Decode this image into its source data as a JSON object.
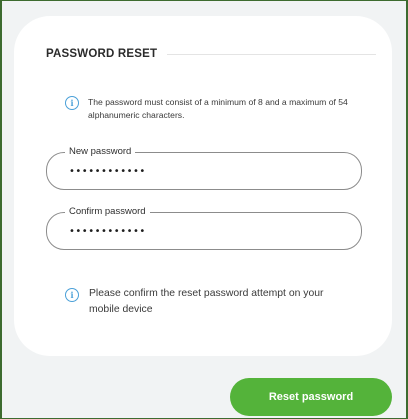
{
  "card": {
    "title": "PASSWORD RESET",
    "requirement_note": "The password must consist of a minimum of 8 and a maximum of 54 alphanumeric characters.",
    "new_password": {
      "label": "New password",
      "value": "••••••••••••"
    },
    "confirm_password": {
      "label": "Confirm password",
      "value": "••••••••••••"
    },
    "mobile_note": "Please confirm the reset password attempt on your mobile device"
  },
  "actions": {
    "reset_label": "Reset password"
  },
  "icons": {
    "info": "info-icon"
  },
  "colors": {
    "accent_button": "#54b33a",
    "info_icon": "#4aa0d8",
    "card_background": "#ffffff",
    "page_background": "#f1f3f4"
  }
}
